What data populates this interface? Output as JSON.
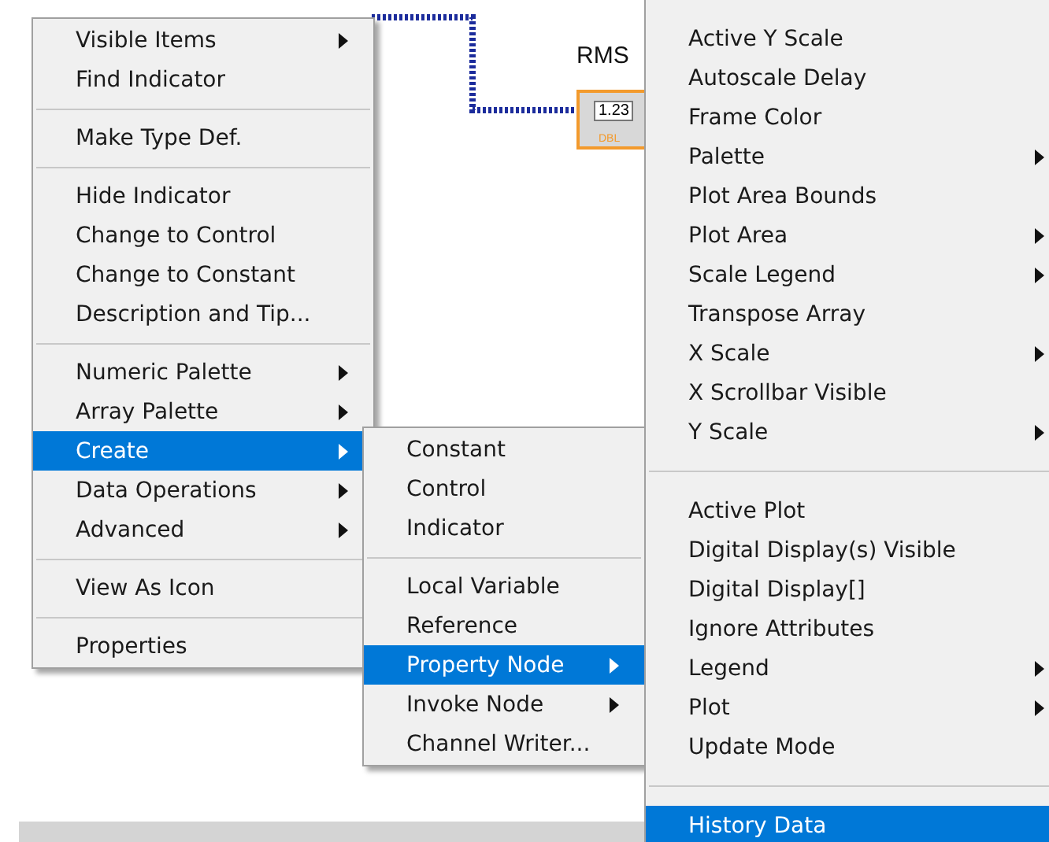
{
  "diagram": {
    "indicator_label": "RMS",
    "indicator_value": "1.23",
    "indicator_type": "DBL"
  },
  "menus": [
    {
      "items": [
        {
          "kind": "item",
          "label": "Visible Items",
          "submenu": true,
          "selected": false
        },
        {
          "kind": "item",
          "label": "Find Indicator",
          "submenu": false,
          "selected": false
        },
        {
          "kind": "separator"
        },
        {
          "kind": "item",
          "label": "Make Type Def.",
          "submenu": false,
          "selected": false
        },
        {
          "kind": "separator"
        },
        {
          "kind": "item",
          "label": "Hide Indicator",
          "submenu": false,
          "selected": false
        },
        {
          "kind": "item",
          "label": "Change to Control",
          "submenu": false,
          "selected": false
        },
        {
          "kind": "item",
          "label": "Change to Constant",
          "submenu": false,
          "selected": false
        },
        {
          "kind": "item",
          "label": "Description and Tip...",
          "submenu": false,
          "selected": false
        },
        {
          "kind": "separator"
        },
        {
          "kind": "item",
          "label": "Numeric Palette",
          "submenu": true,
          "selected": false
        },
        {
          "kind": "item",
          "label": "Array Palette",
          "submenu": true,
          "selected": false
        },
        {
          "kind": "item",
          "label": "Create",
          "submenu": true,
          "selected": true
        },
        {
          "kind": "item",
          "label": "Data Operations",
          "submenu": true,
          "selected": false
        },
        {
          "kind": "item",
          "label": "Advanced",
          "submenu": true,
          "selected": false
        },
        {
          "kind": "separator"
        },
        {
          "kind": "item",
          "label": "View As Icon",
          "submenu": false,
          "selected": false
        },
        {
          "kind": "separator"
        },
        {
          "kind": "item",
          "label": "Properties",
          "submenu": false,
          "selected": false
        }
      ]
    },
    {
      "items": [
        {
          "kind": "item",
          "label": "Constant",
          "submenu": false,
          "selected": false
        },
        {
          "kind": "item",
          "label": "Control",
          "submenu": false,
          "selected": false
        },
        {
          "kind": "item",
          "label": "Indicator",
          "submenu": false,
          "selected": false
        },
        {
          "kind": "separator"
        },
        {
          "kind": "item",
          "label": "Local Variable",
          "submenu": false,
          "selected": false
        },
        {
          "kind": "item",
          "label": "Reference",
          "submenu": false,
          "selected": false
        },
        {
          "kind": "item",
          "label": "Property Node",
          "submenu": true,
          "selected": true
        },
        {
          "kind": "item",
          "label": "Invoke Node",
          "submenu": true,
          "selected": false
        },
        {
          "kind": "item",
          "label": "Channel Writer...",
          "submenu": false,
          "selected": false
        }
      ]
    },
    {
      "items": [
        {
          "kind": "item",
          "label": "Active Y Scale",
          "submenu": false,
          "selected": false
        },
        {
          "kind": "item",
          "label": "Autoscale Delay",
          "submenu": false,
          "selected": false
        },
        {
          "kind": "item",
          "label": "Frame Color",
          "submenu": false,
          "selected": false
        },
        {
          "kind": "item",
          "label": "Palette",
          "submenu": true,
          "selected": false
        },
        {
          "kind": "item",
          "label": "Plot Area Bounds",
          "submenu": false,
          "selected": false
        },
        {
          "kind": "item",
          "label": "Plot Area",
          "submenu": true,
          "selected": false
        },
        {
          "kind": "item",
          "label": "Scale Legend",
          "submenu": true,
          "selected": false
        },
        {
          "kind": "item",
          "label": "Transpose Array",
          "submenu": false,
          "selected": false
        },
        {
          "kind": "item",
          "label": "X Scale",
          "submenu": true,
          "selected": false
        },
        {
          "kind": "item",
          "label": "X Scrollbar Visible",
          "submenu": false,
          "selected": false
        },
        {
          "kind": "item",
          "label": "Y Scale",
          "submenu": true,
          "selected": false
        },
        {
          "kind": "separator"
        },
        {
          "kind": "item",
          "label": "Active Plot",
          "submenu": false,
          "selected": false
        },
        {
          "kind": "item",
          "label": "Digital Display(s) Visible",
          "submenu": false,
          "selected": false
        },
        {
          "kind": "item",
          "label": "Digital Display[]",
          "submenu": false,
          "selected": false
        },
        {
          "kind": "item",
          "label": "Ignore Attributes",
          "submenu": false,
          "selected": false
        },
        {
          "kind": "item",
          "label": "Legend",
          "submenu": true,
          "selected": false
        },
        {
          "kind": "item",
          "label": "Plot",
          "submenu": true,
          "selected": false
        },
        {
          "kind": "item",
          "label": "Update Mode",
          "submenu": false,
          "selected": false
        },
        {
          "kind": "separator"
        },
        {
          "kind": "item",
          "label": "History Data",
          "submenu": false,
          "selected": true
        }
      ]
    }
  ]
}
